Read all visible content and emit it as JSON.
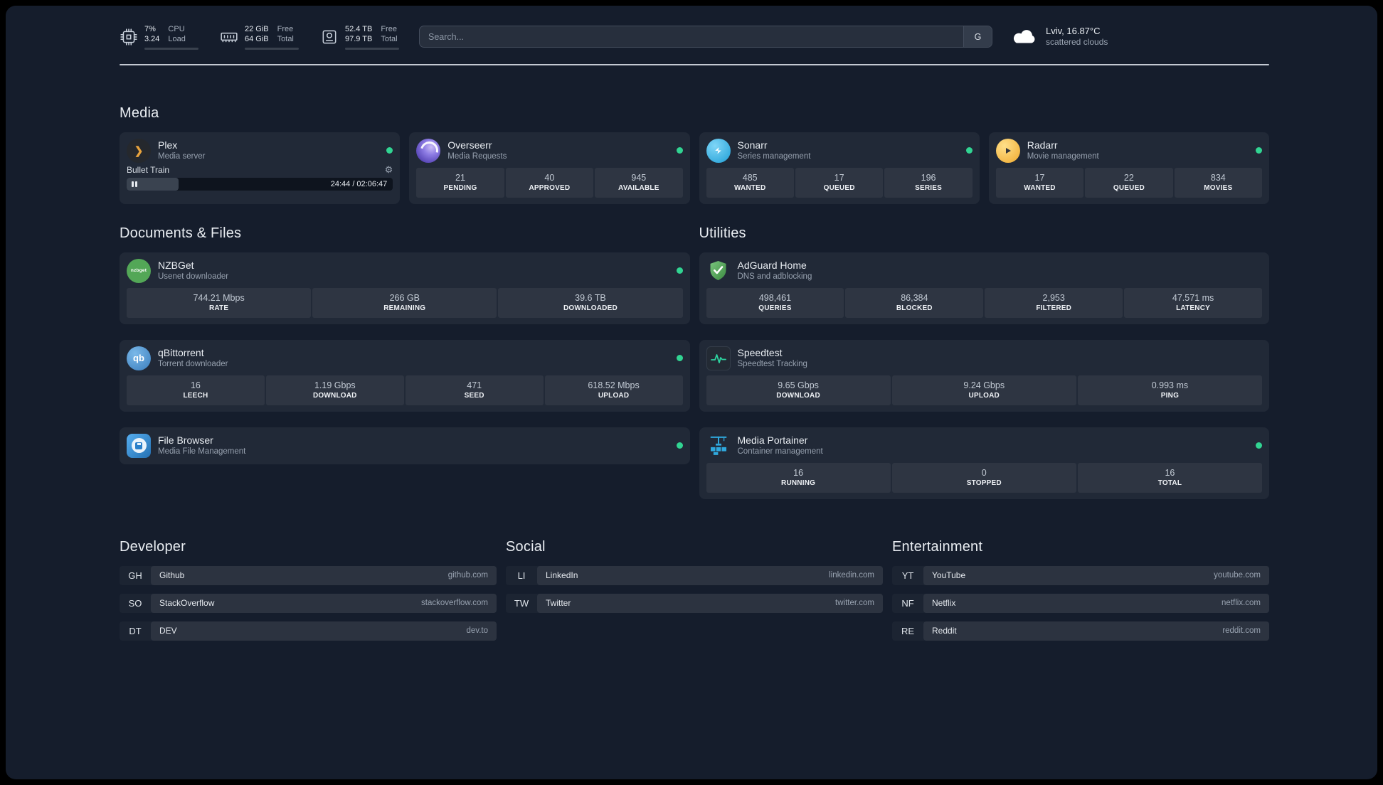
{
  "colors": {
    "background": "#151d2c",
    "status_online": "#31d492",
    "plex_accent": "#e8a33d",
    "adguard_green": "#5cab60",
    "portainer_blue": "#2fa8dd"
  },
  "topbar": {
    "cpu": {
      "value_top": "7%",
      "value_bottom": "3.24",
      "label_top": "CPU",
      "label_bottom": "Load",
      "bar_percent": 45
    },
    "memory": {
      "value_top": "22 GiB",
      "value_bottom": "64 GiB",
      "label_top": "Free",
      "label_bottom": "Total",
      "bar_percent": 66
    },
    "disk": {
      "value_top": "52.4 TB",
      "value_bottom": "97.9 TB",
      "label_top": "Free",
      "label_bottom": "Total",
      "bar_percent": 53
    },
    "search": {
      "placeholder": "Search...",
      "provider_button": "G"
    },
    "weather": {
      "location": "Lviv, 16.87°C",
      "condition": "scattered clouds"
    }
  },
  "media": {
    "title": "Media",
    "plex": {
      "name": "Plex",
      "subtitle": "Media server",
      "now_playing": "Bullet Train",
      "time": "24:44 / 02:06:47",
      "progress_percent": 19.5
    },
    "overseerr": {
      "name": "Overseerr",
      "subtitle": "Media Requests",
      "stats": [
        {
          "value": "21",
          "label": "PENDING"
        },
        {
          "value": "40",
          "label": "APPROVED"
        },
        {
          "value": "945",
          "label": "AVAILABLE"
        }
      ]
    },
    "sonarr": {
      "name": "Sonarr",
      "subtitle": "Series management",
      "stats": [
        {
          "value": "485",
          "label": "WANTED"
        },
        {
          "value": "17",
          "label": "QUEUED"
        },
        {
          "value": "196",
          "label": "SERIES"
        }
      ]
    },
    "radarr": {
      "name": "Radarr",
      "subtitle": "Movie management",
      "stats": [
        {
          "value": "17",
          "label": "WANTED"
        },
        {
          "value": "22",
          "label": "QUEUED"
        },
        {
          "value": "834",
          "label": "MOVIES"
        }
      ]
    }
  },
  "documents": {
    "title": "Documents & Files",
    "nzbget": {
      "name": "NZBGet",
      "subtitle": "Usenet downloader",
      "icon_text": "nzbget",
      "stats": [
        {
          "value": "744.21 Mbps",
          "label": "RATE"
        },
        {
          "value": "266 GB",
          "label": "REMAINING"
        },
        {
          "value": "39.6 TB",
          "label": "DOWNLOADED"
        }
      ]
    },
    "qbittorrent": {
      "name": "qBittorrent",
      "subtitle": "Torrent downloader",
      "icon_text": "qb",
      "stats": [
        {
          "value": "16",
          "label": "LEECH"
        },
        {
          "value": "1.19 Gbps",
          "label": "DOWNLOAD"
        },
        {
          "value": "471",
          "label": "SEED"
        },
        {
          "value": "618.52 Mbps",
          "label": "UPLOAD"
        }
      ]
    },
    "filebrowser": {
      "name": "File Browser",
      "subtitle": "Media File Management"
    }
  },
  "utilities": {
    "title": "Utilities",
    "adguard": {
      "name": "AdGuard Home",
      "subtitle": "DNS and adblocking",
      "stats": [
        {
          "value": "498,461",
          "label": "QUERIES"
        },
        {
          "value": "86,384",
          "label": "BLOCKED"
        },
        {
          "value": "2,953",
          "label": "FILTERED"
        },
        {
          "value": "47.571 ms",
          "label": "LATENCY"
        }
      ]
    },
    "speedtest": {
      "name": "Speedtest",
      "subtitle": "Speedtest Tracking",
      "stats": [
        {
          "value": "9.65 Gbps",
          "label": "DOWNLOAD"
        },
        {
          "value": "9.24 Gbps",
          "label": "UPLOAD"
        },
        {
          "value": "0.993 ms",
          "label": "PING"
        }
      ]
    },
    "portainer": {
      "name": "Media Portainer",
      "subtitle": "Container management",
      "stats": [
        {
          "value": "16",
          "label": "RUNNING"
        },
        {
          "value": "0",
          "label": "STOPPED"
        },
        {
          "value": "16",
          "label": "TOTAL"
        }
      ]
    }
  },
  "bookmarks": {
    "developer": {
      "title": "Developer",
      "links": [
        {
          "abbr": "GH",
          "name": "Github",
          "domain": "github.com"
        },
        {
          "abbr": "SO",
          "name": "StackOverflow",
          "domain": "stackoverflow.com"
        },
        {
          "abbr": "DT",
          "name": "DEV",
          "domain": "dev.to"
        }
      ]
    },
    "social": {
      "title": "Social",
      "links": [
        {
          "abbr": "LI",
          "name": "LinkedIn",
          "domain": "linkedin.com"
        },
        {
          "abbr": "TW",
          "name": "Twitter",
          "domain": "twitter.com"
        }
      ]
    },
    "entertainment": {
      "title": "Entertainment",
      "links": [
        {
          "abbr": "YT",
          "name": "YouTube",
          "domain": "youtube.com"
        },
        {
          "abbr": "NF",
          "name": "Netflix",
          "domain": "netflix.com"
        },
        {
          "abbr": "RE",
          "name": "Reddit",
          "domain": "reddit.com"
        }
      ]
    }
  }
}
